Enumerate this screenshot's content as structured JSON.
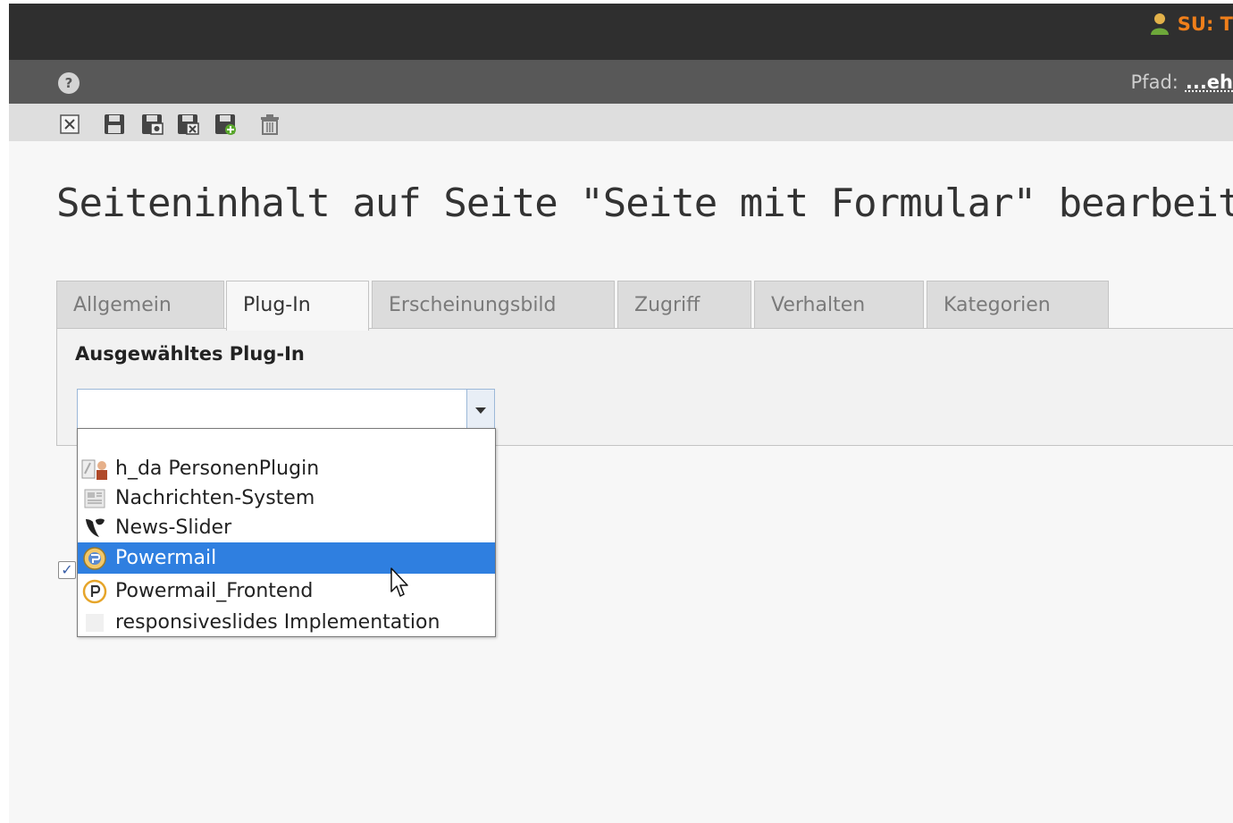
{
  "topbar": {
    "user_label": "SU: T"
  },
  "docheader": {
    "path_label": "Pfad:",
    "path_value": "...eh"
  },
  "toolbar": {
    "icons": [
      "close-icon",
      "save-icon",
      "save-view-icon",
      "save-close-icon",
      "save-new-icon",
      "delete-icon"
    ]
  },
  "page": {
    "title": "Seiteninhalt auf Seite \"Seite mit Formular\" bearbeiten"
  },
  "tabs": [
    {
      "label": "Allgemein"
    },
    {
      "label": "Plug-In"
    },
    {
      "label": "Erscheinungsbild"
    },
    {
      "label": "Zugriff"
    },
    {
      "label": "Verhalten"
    },
    {
      "label": "Kategorien"
    }
  ],
  "active_tab": "Plug-In",
  "plugin_panel": {
    "label": "Ausgewähltes Plug-In",
    "selected_value": ""
  },
  "dropdown": {
    "options": [
      {
        "label": "h_da PersonenPlugin",
        "icon": "person-plugin-icon"
      },
      {
        "label": "Nachrichten-System",
        "icon": "news-system-icon"
      },
      {
        "label": "News-Slider",
        "icon": "typo3-icon"
      },
      {
        "label": "Powermail",
        "icon": "powermail-icon"
      },
      {
        "label": "Powermail_Frontend",
        "icon": "powermail-frontend-icon"
      },
      {
        "label": "responsiveslides Implementation",
        "icon": "blank-plugin-icon"
      }
    ],
    "highlighted": "Powermail"
  },
  "colors": {
    "topbar": "#2f2f2f",
    "docheader": "#585858",
    "accent_orange": "#f07f1a",
    "selection_blue": "#2f7fe0"
  }
}
